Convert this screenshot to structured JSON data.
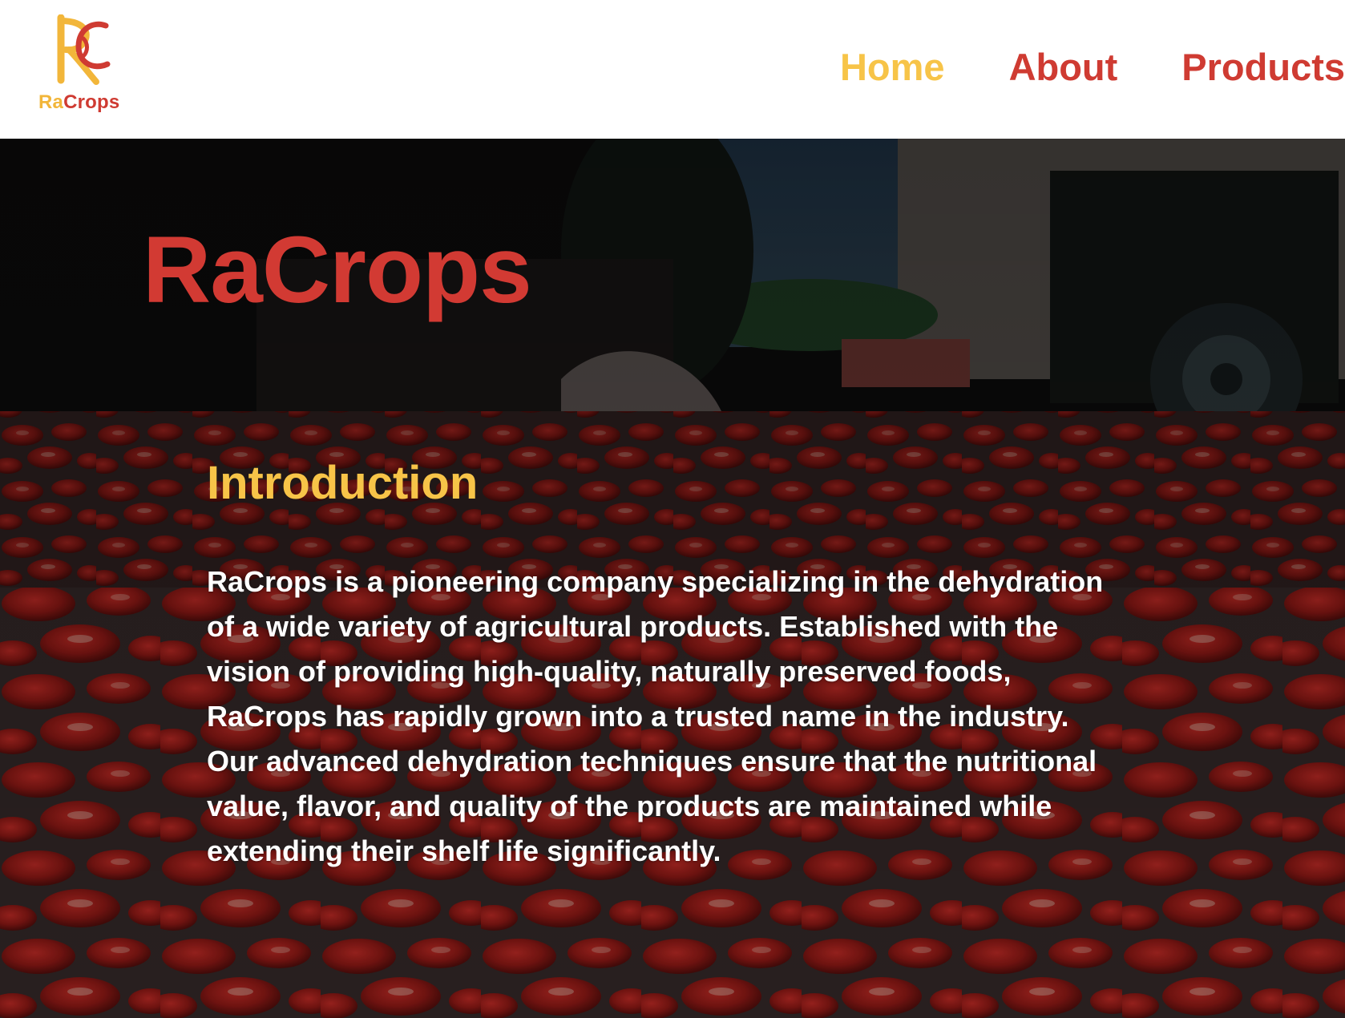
{
  "header": {
    "logo": {
      "text_ra": "Ra",
      "text_crops": "Crops"
    },
    "nav": [
      {
        "label": "Home",
        "active": true
      },
      {
        "label": "About",
        "active": false
      },
      {
        "label": "Products",
        "active": false
      }
    ]
  },
  "hero": {
    "title": "RaCrops",
    "intro_heading": "Introduction",
    "intro_text": "RaCrops is a pioneering company specializing in the dehydration of a wide variety of agricultural products. Established with the vision of providing high-quality, naturally preserved foods, RaCrops has rapidly grown into a trusted name in the industry. Our advanced dehydration techniques ensure that the nutritional value, flavor, and quality of the products are maintained while extending their shelf life significantly."
  },
  "colors": {
    "brand_red": "#cf3b32",
    "brand_yellow": "#f7c448",
    "text_white": "#ffffff"
  }
}
